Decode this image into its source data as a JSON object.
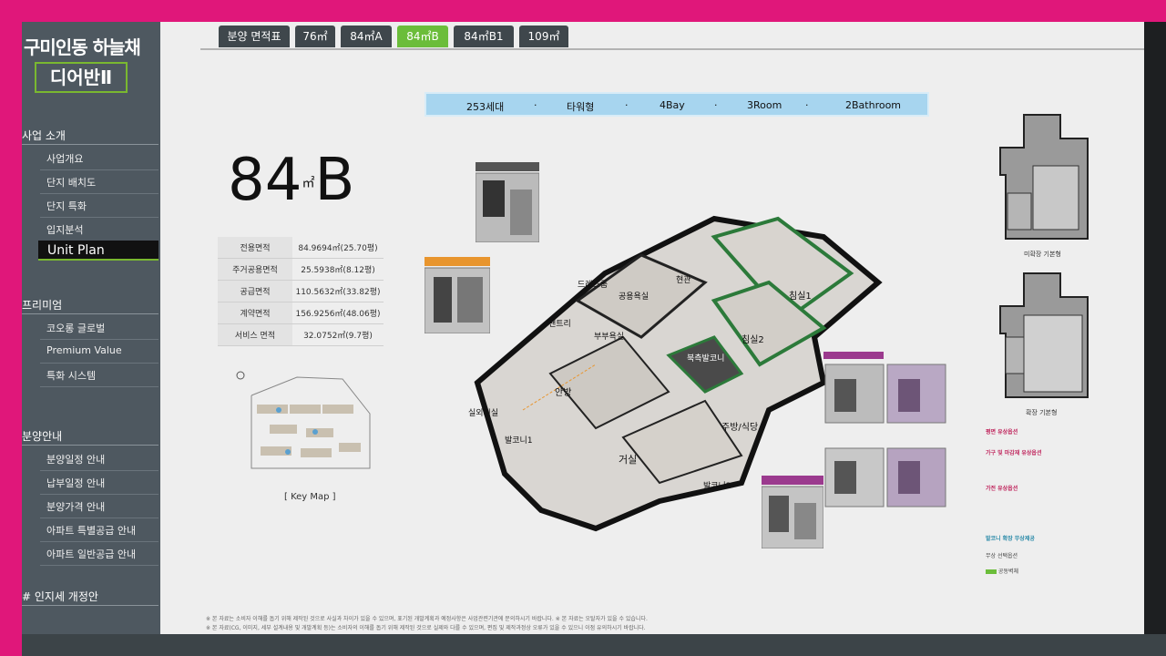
{
  "sidebar": {
    "logo_line1": "구미인동 하늘채",
    "logo_line2": "디어반Ⅱ",
    "sections": [
      {
        "title": "사업 소개",
        "items": [
          "사업개요",
          "단지 배치도",
          "단지 특화",
          "입지분석"
        ]
      },
      {
        "title": "프리미엄",
        "items": [
          "코오롱 글로벌",
          "Premium Value",
          "특화 시스템"
        ]
      },
      {
        "title": "분양안내",
        "items": [
          "분양일정 안내",
          "납부일정 안내",
          "분양가격 안내",
          "아파트 특별공급 안내",
          "아파트 일반공급 안내"
        ]
      },
      {
        "title": "# 인지세 개정안",
        "items": []
      }
    ],
    "active_item": "Unit Plan"
  },
  "tabs": [
    "분양 면적표",
    "76㎡",
    "84㎡A",
    "84㎡B",
    "84㎡B1",
    "109㎡"
  ],
  "active_tab": "84㎡B",
  "features": [
    "253세대",
    "타워형",
    "4Bay",
    "3Room",
    "2Bathroom"
  ],
  "feature_sep": "·",
  "unit_title": "84",
  "unit_unit": "㎡",
  "unit_letter": "B",
  "area_table": [
    {
      "label": "전용면적",
      "value": "84.9694㎡(25.70평)"
    },
    {
      "label": "주거공용면적",
      "value": "25.5938㎡(8.12평)"
    },
    {
      "label": "공급면적",
      "value": "110.5632㎡(33.82평)"
    },
    {
      "label": "계약면적",
      "value": "156.9256㎡(48.06평)"
    },
    {
      "label": "서비스 면적",
      "value": "32.0752㎡(9.7평)"
    }
  ],
  "key_map_label": "[ Key  Map ]",
  "rooms": {
    "dress": "드레스룸",
    "bath_common": "공용욕실",
    "hall": "현관",
    "bed1": "침실1",
    "bed2": "침실2",
    "pantry": "팬트리",
    "bath_master": "부부욕실",
    "north_balcony": "북측발코니",
    "master": "안방",
    "kitchen": "주방/식당",
    "airroom": "실외기실",
    "balcony1": "발코니1",
    "living": "거실",
    "balcony2": "발코니2"
  },
  "mini_labels": {
    "basic": "미확장 기본형",
    "ext": "확장 기본형"
  },
  "legend": {
    "h1": "평면 유상옵션",
    "h2": "가구 및 마감재 유상옵션",
    "h3": "가전 유상옵션",
    "h4": "발코니 확장 무상제공",
    "h5": "무상 선택옵션",
    "h6": "공동벽체"
  },
  "notes": [
    "※ 본 자료는 소비자 이해를 돕기 위해 제작된 것으로 사실과 차이가 있을 수 있으며, 표기된 개발계획과 예정사항은 사업관련기관에 문의하시기 바랍니다.   ※ 본 자료는 오탈자가 있을 수 있습니다.",
    "※ 본 자료(CG, 이미지, 세부 설계내용 및 개발계획 등)는 소비자의 이해를 돕기 위해 제작된 것으로 실제와 다를 수 있으며, 편집 및 제작과정상 오류가 있을 수 있으니 이점 유의하시기 바랍니다."
  ],
  "colors": {
    "accent_pink": "#e0177a",
    "accent_green": "#6bbd3a",
    "sidebar_bg": "#4e5860",
    "feature_bar": "#a7d5ef",
    "option_orange": "#e8952e",
    "option_purple": "#9b3a8e"
  }
}
